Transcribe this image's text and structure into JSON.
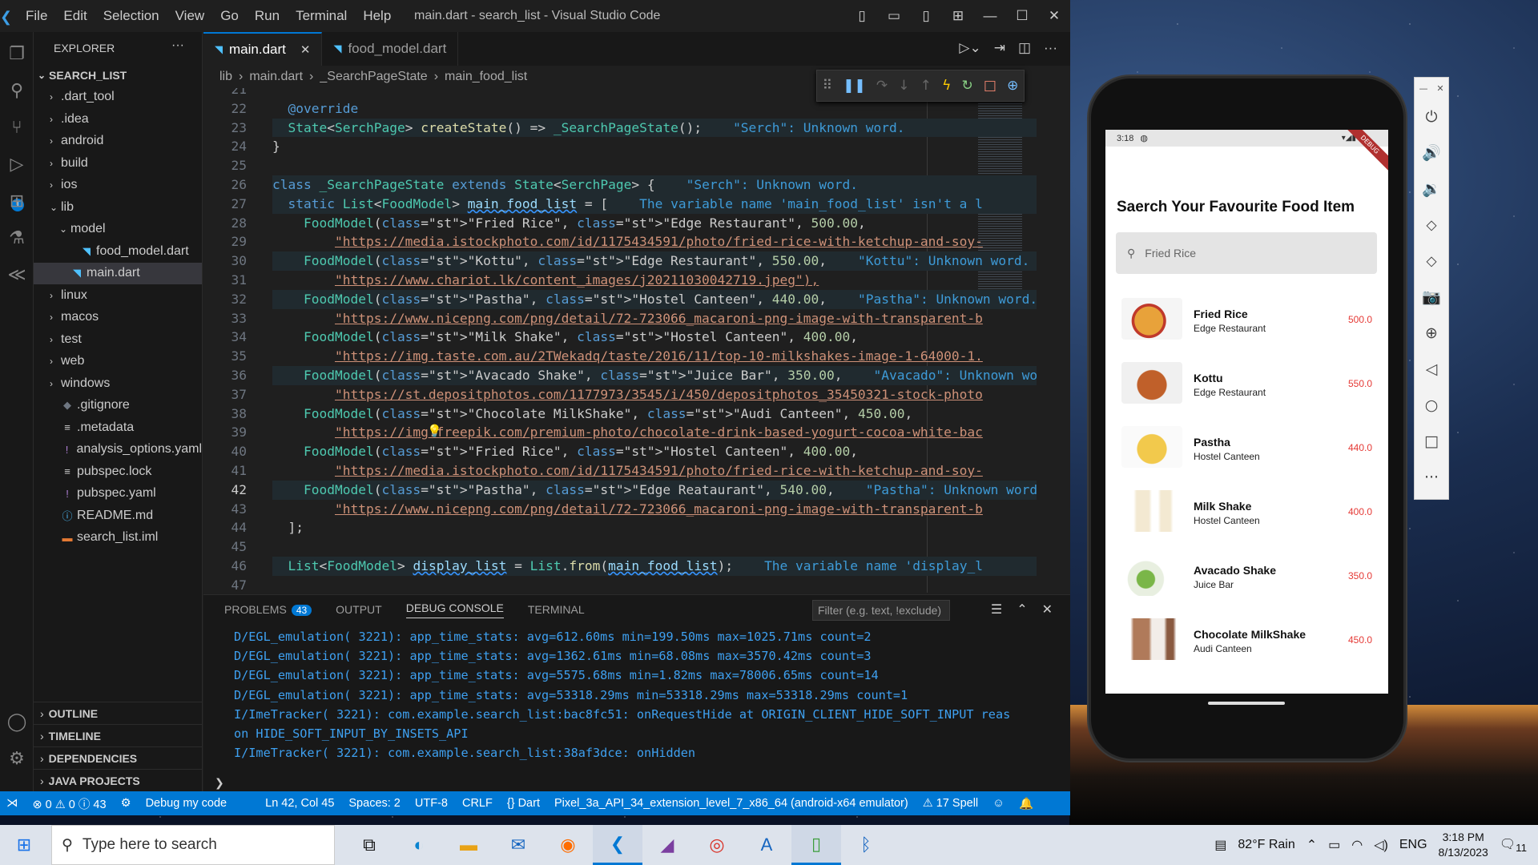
{
  "window": {
    "title": "main.dart - search_list - Visual Studio Code",
    "menu": [
      "File",
      "Edit",
      "Selection",
      "View",
      "Go",
      "Run",
      "Terminal",
      "Help"
    ]
  },
  "explorer": {
    "header": "EXPLORER",
    "root": "SEARCH_LIST",
    "items": [
      ".dart_tool",
      ".idea",
      "android",
      "build",
      "ios",
      "lib",
      "model",
      "food_model.dart",
      "main.dart",
      "linux",
      "macos",
      "test",
      "web",
      "windows",
      ".gitignore",
      ".metadata",
      "analysis_options.yaml",
      "pubspec.lock",
      "pubspec.yaml",
      "README.md",
      "search_list.iml"
    ],
    "sections": [
      "OUTLINE",
      "TIMELINE",
      "DEPENDENCIES",
      "JAVA PROJECTS"
    ]
  },
  "activity_badge": "1",
  "tabs": [
    {
      "label": "main.dart"
    },
    {
      "label": "food_model.dart"
    }
  ],
  "breadcrumb": [
    "lib",
    "main.dart",
    "_SearchPageState",
    "main_food_list"
  ],
  "code": {
    "lines": [
      {
        "n": "21",
        "t": ""
      },
      {
        "n": "22",
        "t": "@override"
      },
      {
        "n": "23",
        "t": "State<SerchPage> createState() => _SearchPageState();",
        "hint": "\"Serch\": Unknown word."
      },
      {
        "n": "24",
        "t": "}"
      },
      {
        "n": "25",
        "t": ""
      },
      {
        "n": "26",
        "t": "class _SearchPageState extends State<SerchPage> {",
        "hint": "\"Serch\": Unknown word."
      },
      {
        "n": "27",
        "t": "static List<FoodModel> main_food_list = [",
        "hint": "The variable name 'main_food_list' isn't a l"
      },
      {
        "n": "28",
        "t": "FoodModel(\"Fried Rice\", \"Edge Restaurant\", 500.00,"
      },
      {
        "n": "29",
        "t": "\"https://media.istockphoto.com/id/1175434591/photo/fried-rice-with-ketchup-and-soy-"
      },
      {
        "n": "30",
        "t": "FoodModel(\"Kottu\", \"Edge Restaurant\", 550.00,",
        "hint": "\"Kottu\": Unknown word."
      },
      {
        "n": "31",
        "t": "\"https://www.chariot.lk/content_images/j20211030042719.jpeg\"),"
      },
      {
        "n": "32",
        "t": "FoodModel(\"Pastha\", \"Hostel Canteen\", 440.00,",
        "hint": "\"Pastha\": Unknown word."
      },
      {
        "n": "33",
        "t": "\"https://www.nicepng.com/png/detail/72-723066_macaroni-png-image-with-transparent-b"
      },
      {
        "n": "34",
        "t": "FoodModel(\"Milk Shake\", \"Hostel Canteen\", 400.00,"
      },
      {
        "n": "35",
        "t": "\"https://img.taste.com.au/2TWekadq/taste/2016/11/top-10-milkshakes-image-1-64000-1."
      },
      {
        "n": "36",
        "t": "FoodModel(\"Avacado Shake\", \"Juice Bar\", 350.00,",
        "hint": "\"Avacado\": Unknown word."
      },
      {
        "n": "37",
        "t": "\"https://st.depositphotos.com/1177973/3545/i/450/depositphotos_35450321-stock-photo"
      },
      {
        "n": "38",
        "t": "FoodModel(\"Chocolate MilkShake\", \"Audi Canteen\", 450.00,"
      },
      {
        "n": "39",
        "t": "\"https://img.freepik.com/premium-photo/chocolate-drink-based-yogurt-cocoa-white-bac"
      },
      {
        "n": "40",
        "t": "FoodModel(\"Fried Rice\", \"Hostel Canteen\", 400.00,"
      },
      {
        "n": "41",
        "t": "\"https://media.istockphoto.com/id/1175434591/photo/fried-rice-with-ketchup-and-soy-"
      },
      {
        "n": "42",
        "t": "FoodModel(\"Pastha\", \"Edge Reataurant\", 540.00,",
        "hint": "\"Pastha\": Unknown word."
      },
      {
        "n": "43",
        "t": "\"https://www.nicepng.com/png/detail/72-723066_macaroni-png-image-with-transparent-b"
      },
      {
        "n": "44",
        "t": "];"
      },
      {
        "n": "45",
        "t": ""
      },
      {
        "n": "46",
        "t": "List<FoodModel> display_list = List.from(main_food_list);",
        "hint": "The variable name 'display_l"
      },
      {
        "n": "47",
        "t": ""
      }
    ]
  },
  "panel": {
    "tabs": [
      "PROBLEMS",
      "OUTPUT",
      "DEBUG CONSOLE",
      "TERMINAL"
    ],
    "problems_count": "43",
    "filter_placeholder": "Filter (e.g. text, !exclude)",
    "console": [
      "D/EGL_emulation( 3221): app_time_stats: avg=612.60ms min=199.50ms max=1025.71ms count=2",
      "D/EGL_emulation( 3221): app_time_stats: avg=1362.61ms min=68.08ms max=3570.42ms count=3",
      "D/EGL_emulation( 3221): app_time_stats: avg=5575.68ms min=1.82ms max=78006.65ms count=14",
      "D/EGL_emulation( 3221): app_time_stats: avg=53318.29ms min=53318.29ms max=53318.29ms count=1",
      "I/ImeTracker( 3221): com.example.search_list:bac8fc51: onRequestHide at ORIGIN_CLIENT_HIDE_SOFT_INPUT reas",
      "on HIDE_SOFT_INPUT_BY_INSETS_API",
      "I/ImeTracker( 3221): com.example.search_list:38af3dce: onHidden"
    ]
  },
  "status": {
    "problems": "⊗ 0 ⚠ 0 ⓘ 43",
    "debug": "Debug my code",
    "position": "Ln 42, Col 45",
    "spaces": "Spaces: 2",
    "encoding": "UTF-8",
    "eol": "CRLF",
    "language": "{} Dart",
    "device": "Pixel_3a_API_34_extension_level_7_x86_64 (android-x64 emulator)",
    "spell": "⚠ 17 Spell"
  },
  "phone": {
    "time": "3:18",
    "ribbon": "DEBUG",
    "title": "Saerch Your Favourite Food Item",
    "search_value": "Fried Rice",
    "items": [
      {
        "name": "Fried Rice",
        "place": "Edge Restaurant",
        "price": "500.0"
      },
      {
        "name": "Kottu",
        "place": "Edge Restaurant",
        "price": "550.0"
      },
      {
        "name": "Pastha",
        "place": "Hostel Canteen",
        "price": "440.0"
      },
      {
        "name": "Milk Shake",
        "place": "Hostel Canteen",
        "price": "400.0"
      },
      {
        "name": "Avacado Shake",
        "place": "Juice Bar",
        "price": "350.0"
      },
      {
        "name": "Chocolate MilkShake",
        "place": "Audi Canteen",
        "price": "450.0"
      }
    ]
  },
  "taskbar": {
    "search_placeholder": "Type here to search",
    "weather": "82°F Rain",
    "lang": "ENG",
    "time": "3:18 PM",
    "date": "8/13/2023",
    "notif": "11"
  }
}
